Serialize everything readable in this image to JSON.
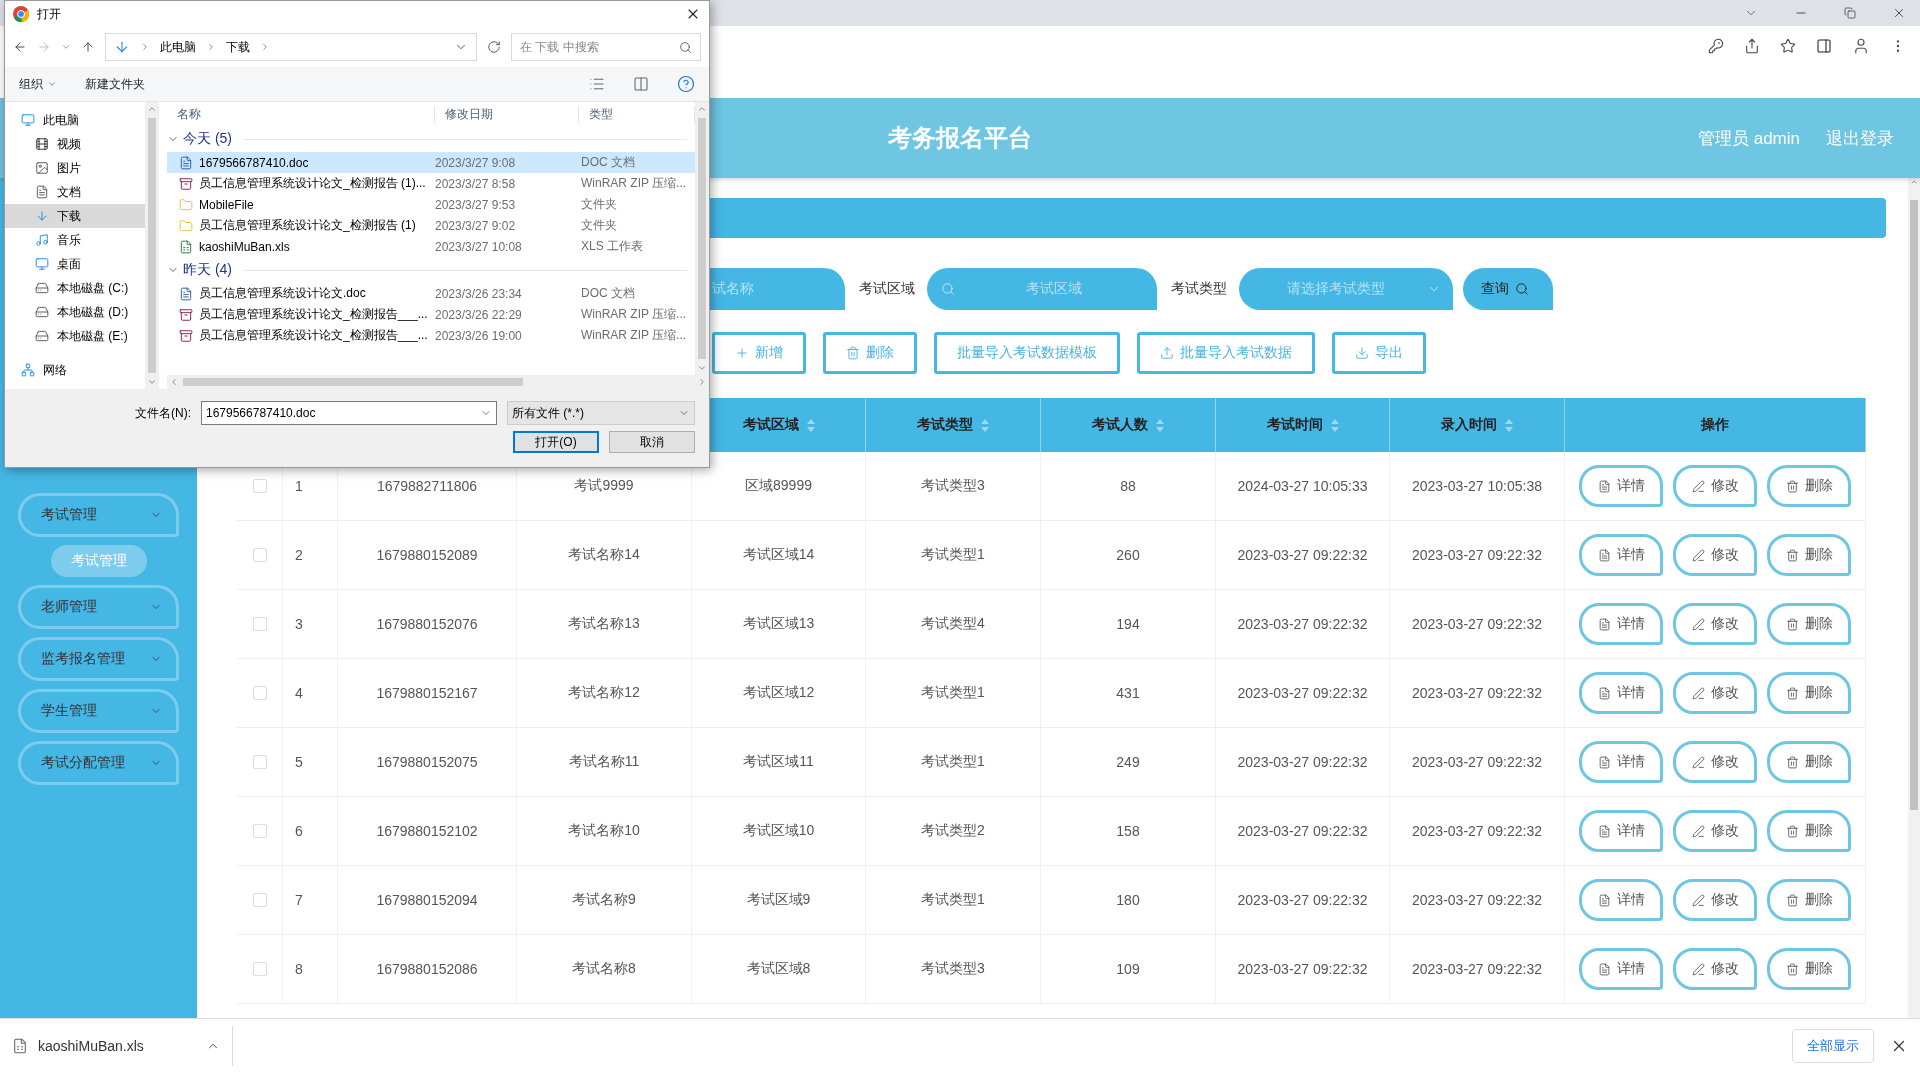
{
  "dialog": {
    "title": "打开",
    "path": [
      "此电脑",
      "下载"
    ],
    "search_placeholder": "在 下载 中搜索",
    "toolbar": [
      "组织",
      "新建文件夹"
    ],
    "nav": [
      {
        "label": "此电脑",
        "kind": "pc",
        "selected": false,
        "children": [
          {
            "label": "视频",
            "kind": "video",
            "selected": false
          },
          {
            "label": "图片",
            "kind": "picture",
            "selected": false
          },
          {
            "label": "文档",
            "kind": "docs",
            "selected": false
          },
          {
            "label": "下载",
            "kind": "download",
            "selected": true
          },
          {
            "label": "音乐",
            "kind": "music",
            "selected": false
          },
          {
            "label": "桌面",
            "kind": "desktop",
            "selected": false
          },
          {
            "label": "本地磁盘 (C:)",
            "kind": "drive",
            "selected": false
          },
          {
            "label": "本地磁盘 (D:)",
            "kind": "drive",
            "selected": false
          },
          {
            "label": "本地磁盘 (E:)",
            "kind": "drive",
            "selected": false
          }
        ]
      },
      {
        "label": "网络",
        "kind": "network",
        "selected": false
      }
    ],
    "columns": [
      "名称",
      "修改日期",
      "类型"
    ],
    "groups": [
      {
        "label": "今天 (5)",
        "expanded": true,
        "files": [
          {
            "name": "1679566787410.doc",
            "date": "2023/3/27 9:08",
            "type": "DOC 文档",
            "kind": "doc",
            "selected": true
          },
          {
            "name": "员工信息管理系统设计论文_检测报告 (1)...",
            "date": "2023/3/27 8:58",
            "type": "WinRAR ZIP 压缩...",
            "kind": "zip",
            "selected": false
          },
          {
            "name": "MobileFile",
            "date": "2023/3/27 9:53",
            "type": "文件夹",
            "kind": "folder",
            "selected": false
          },
          {
            "name": "员工信息管理系统设计论文_检测报告 (1)",
            "date": "2023/3/27 9:02",
            "type": "文件夹",
            "kind": "folder",
            "selected": false
          },
          {
            "name": "kaoshiMuBan.xls",
            "date": "2023/3/27 10:08",
            "type": "XLS 工作表",
            "kind": "xls",
            "selected": false
          }
        ]
      },
      {
        "label": "昨天 (4)",
        "expanded": true,
        "files": [
          {
            "name": "员工信息管理系统设计论文.doc",
            "date": "2023/3/26 23:34",
            "type": "DOC 文档",
            "kind": "doc",
            "selected": false
          },
          {
            "name": "员工信息管理系统设计论文_检测报告___...",
            "date": "2023/3/26 22:29",
            "type": "WinRAR ZIP 压缩...",
            "kind": "zip",
            "selected": false
          },
          {
            "name": "员工信息管理系统设计论文_检测报告___...",
            "date": "2023/3/26 19:00",
            "type": "WinRAR ZIP 压缩...",
            "kind": "zip",
            "selected": false
          }
        ]
      }
    ],
    "filename_label": "文件名(N):",
    "filename": "1679566787410.doc",
    "filter": "所有文件 (*.*)",
    "buttons": [
      "打开(O)",
      "取消"
    ]
  },
  "header": {
    "title": "考务报名平台",
    "user": "管理员 admin",
    "logout": "退出登录"
  },
  "sidebar": {
    "items": [
      {
        "label": "考试管理",
        "children": [
          {
            "label": "考试管理",
            "selected": true
          }
        ]
      },
      {
        "label": "老师管理"
      },
      {
        "label": "监考报名管理"
      },
      {
        "label": "学生管理"
      },
      {
        "label": "考试分配管理"
      }
    ]
  },
  "filters": {
    "fields": [
      {
        "kind": "input",
        "placeholder": "试名称"
      },
      {
        "kind": "input",
        "label": "考试区域",
        "placeholder": "考试区域"
      },
      {
        "kind": "select",
        "label": "考试类型",
        "placeholder": "请选择考试类型"
      }
    ],
    "query": "查询"
  },
  "actions": [
    {
      "label": "新增",
      "kind": "add"
    },
    {
      "label": "删除",
      "kind": "delete"
    },
    {
      "label": "批量导入考试数据模板",
      "kind": "plain"
    },
    {
      "label": "批量导入考试数据",
      "kind": "upload"
    },
    {
      "label": "导出",
      "kind": "download"
    }
  ],
  "table": {
    "columns": [
      {
        "label": "考试区域",
        "sortable": true
      },
      {
        "label": "考试类型",
        "sortable": true
      },
      {
        "label": "考试人数",
        "sortable": true
      },
      {
        "label": "考试时间",
        "sortable": true
      },
      {
        "label": "录入时间",
        "sortable": true
      },
      {
        "label": "操作",
        "sortable": false
      }
    ],
    "rows": [
      {
        "checked": false,
        "index": "1",
        "id": "1679882711806",
        "name": "考试9999",
        "area": "区域89999",
        "type": "考试类型3",
        "count": "88",
        "exam_time": "2024-03-27 10:05:33",
        "entry_time": "2023-03-27 10:05:38",
        "actions": [
          "详情",
          "修改",
          "删除"
        ]
      },
      {
        "checked": false,
        "index": "2",
        "id": "1679880152089",
        "name": "考试名称14",
        "area": "考试区域14",
        "type": "考试类型1",
        "count": "260",
        "exam_time": "2023-03-27 09:22:32",
        "entry_time": "2023-03-27 09:22:32",
        "actions": [
          "详情",
          "修改",
          "删除"
        ]
      },
      {
        "checked": false,
        "index": "3",
        "id": "1679880152076",
        "name": "考试名称13",
        "area": "考试区域13",
        "type": "考试类型4",
        "count": "194",
        "exam_time": "2023-03-27 09:22:32",
        "entry_time": "2023-03-27 09:22:32",
        "actions": [
          "详情",
          "修改",
          "删除"
        ]
      },
      {
        "checked": false,
        "index": "4",
        "id": "1679880152167",
        "name": "考试名称12",
        "area": "考试区域12",
        "type": "考试类型1",
        "count": "431",
        "exam_time": "2023-03-27 09:22:32",
        "entry_time": "2023-03-27 09:22:32",
        "actions": [
          "详情",
          "修改",
          "删除"
        ]
      },
      {
        "checked": false,
        "index": "5",
        "id": "1679880152075",
        "name": "考试名称11",
        "area": "考试区域11",
        "type": "考试类型1",
        "count": "249",
        "exam_time": "2023-03-27 09:22:32",
        "entry_time": "2023-03-27 09:22:32",
        "actions": [
          "详情",
          "修改",
          "删除"
        ]
      },
      {
        "checked": false,
        "index": "6",
        "id": "1679880152102",
        "name": "考试名称10",
        "area": "考试区域10",
        "type": "考试类型2",
        "count": "158",
        "exam_time": "2023-03-27 09:22:32",
        "entry_time": "2023-03-27 09:22:32",
        "actions": [
          "详情",
          "修改",
          "删除"
        ]
      },
      {
        "checked": false,
        "index": "7",
        "id": "1679880152094",
        "name": "考试名称9",
        "area": "考试区域9",
        "type": "考试类型1",
        "count": "180",
        "exam_time": "2023-03-27 09:22:32",
        "entry_time": "2023-03-27 09:22:32",
        "actions": [
          "详情",
          "修改",
          "删除"
        ]
      },
      {
        "checked": false,
        "index": "8",
        "id": "1679880152086",
        "name": "考试名称8",
        "area": "考试区域8",
        "type": "考试类型3",
        "count": "109",
        "exam_time": "2023-03-27 09:22:32",
        "entry_time": "2023-03-27 09:22:32",
        "actions": [
          "详情",
          "修改",
          "删除"
        ]
      }
    ]
  },
  "download_bar": {
    "file": "kaoshiMuBan.xls",
    "show_all": "全部显示"
  }
}
